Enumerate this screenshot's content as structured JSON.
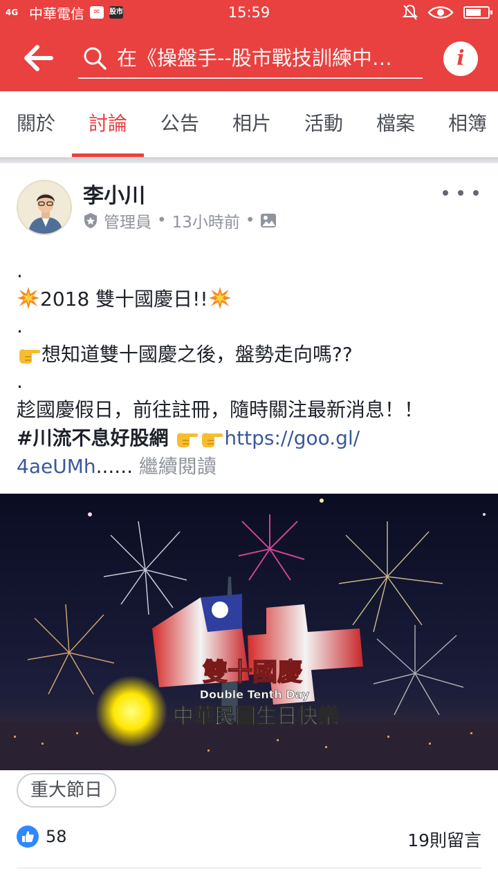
{
  "status_bar": {
    "signal": "4G",
    "carrier": "中華電信",
    "badge1": "✉",
    "badge2": "股市",
    "time": "15:59",
    "battery_level": 0.7
  },
  "header": {
    "search_text": "在《操盤手--股市戰技訓練中…",
    "info_label": "i"
  },
  "tabs": [
    {
      "label": "關於"
    },
    {
      "label": "討論"
    },
    {
      "label": "公告"
    },
    {
      "label": "相片"
    },
    {
      "label": "活動"
    },
    {
      "label": "檔案"
    },
    {
      "label": "相簿"
    }
  ],
  "active_tab": "討論",
  "post": {
    "author": "李小川",
    "role": "管理員",
    "separator": "•",
    "time": "13小時前",
    "line1_dot": ".",
    "line2_text": "2018 雙十國慶日!!",
    "line3_dot": ".",
    "line4_text": "想知道雙十國慶之後，盤勢走向嗎??",
    "line5_dot": ".",
    "line6_text": "趁國慶假日，前往註冊，隨時關注最新消息！！",
    "hashtag": "#川流不息好股網",
    "link_part1": "https://goo.gl/",
    "link_part2": "4aeUMh",
    "ellipsis": "......",
    "see_more": "繼續閱讀",
    "image_title": "雙十國慶",
    "image_subtitle": "Double Tenth Day",
    "image_caption": "中華民國生日快樂",
    "topic": "重大節日",
    "like_count": "58",
    "comment_count": "19則留言"
  },
  "colors": {
    "brand_red": "#e8413f",
    "link_blue": "#385898",
    "like_blue": "#2d88ff"
  },
  "icons": [
    "back-arrow-icon",
    "search-icon",
    "info-icon",
    "shield-icon",
    "photo-icon",
    "more-icon",
    "like-icon",
    "explosion-emoji",
    "pointing-hand-emoji"
  ]
}
